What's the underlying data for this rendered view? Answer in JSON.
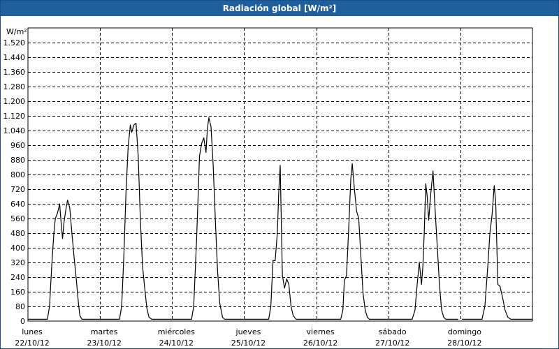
{
  "window": {
    "title": "Radiación global [W/m²]"
  },
  "chart_data": {
    "type": "line",
    "title": "Radiación global [W/m²]",
    "ylabel": "W/m²",
    "ylim": [
      0,
      1600
    ],
    "yticks": [
      {
        "value": 0,
        "label": "0"
      },
      {
        "value": 80,
        "label": "80"
      },
      {
        "value": 160,
        "label": "160"
      },
      {
        "value": 240,
        "label": "240"
      },
      {
        "value": 320,
        "label": "320"
      },
      {
        "value": 400,
        "label": "400"
      },
      {
        "value": 480,
        "label": "480"
      },
      {
        "value": 560,
        "label": "560"
      },
      {
        "value": 640,
        "label": "640"
      },
      {
        "value": 720,
        "label": "720"
      },
      {
        "value": 800,
        "label": "800"
      },
      {
        "value": 880,
        "label": "880"
      },
      {
        "value": 960,
        "label": "960"
      },
      {
        "value": 1040,
        "label": "1.040"
      },
      {
        "value": 1120,
        "label": "1.120"
      },
      {
        "value": 1200,
        "label": "1.200"
      },
      {
        "value": 1280,
        "label": "1.280"
      },
      {
        "value": 1360,
        "label": "1.360"
      },
      {
        "value": 1440,
        "label": "1.440"
      },
      {
        "value": 1520,
        "label": "1.520"
      }
    ],
    "xlim": [
      0,
      7
    ],
    "xticks": [
      {
        "day": "lunes",
        "date": "22/10/12"
      },
      {
        "day": "martes",
        "date": "23/10/12"
      },
      {
        "day": "miércoles",
        "date": "24/10/12"
      },
      {
        "day": "jueves",
        "date": "25/10/12"
      },
      {
        "day": "viernes",
        "date": "26/10/12"
      },
      {
        "day": "sábado",
        "date": "27/10/12"
      },
      {
        "day": "domingo",
        "date": "28/10/12"
      }
    ],
    "grid": true,
    "series": [
      {
        "color": "#000000",
        "segments": [
          [
            [
              0.0,
              10
            ],
            [
              0.27,
              10
            ],
            [
              0.3,
              80
            ],
            [
              0.33,
              300
            ],
            [
              0.36,
              480
            ],
            [
              0.38,
              560
            ],
            [
              0.41,
              590
            ],
            [
              0.44,
              640
            ],
            [
              0.46,
              540
            ],
            [
              0.48,
              450
            ],
            [
              0.5,
              540
            ],
            [
              0.53,
              620
            ],
            [
              0.55,
              660
            ],
            [
              0.58,
              620
            ],
            [
              0.61,
              480
            ],
            [
              0.64,
              350
            ],
            [
              0.67,
              230
            ],
            [
              0.7,
              100
            ],
            [
              0.72,
              30
            ],
            [
              0.75,
              10
            ],
            [
              1.27,
              10
            ],
            [
              1.3,
              80
            ],
            [
              1.33,
              350
            ],
            [
              1.36,
              700
            ],
            [
              1.39,
              950
            ],
            [
              1.42,
              1070
            ],
            [
              1.44,
              1030
            ],
            [
              1.47,
              1070
            ],
            [
              1.5,
              1080
            ],
            [
              1.53,
              900
            ],
            [
              1.56,
              550
            ],
            [
              1.59,
              300
            ],
            [
              1.62,
              180
            ],
            [
              1.65,
              70
            ],
            [
              1.68,
              20
            ],
            [
              1.72,
              10
            ],
            [
              2.27,
              10
            ],
            [
              2.3,
              80
            ],
            [
              2.34,
              450
            ],
            [
              2.38,
              900
            ],
            [
              2.41,
              970
            ],
            [
              2.44,
              1000
            ],
            [
              2.47,
              920
            ],
            [
              2.49,
              1050
            ],
            [
              2.51,
              1110
            ],
            [
              2.54,
              1060
            ],
            [
              2.57,
              850
            ],
            [
              2.6,
              550
            ],
            [
              2.63,
              280
            ],
            [
              2.66,
              100
            ],
            [
              2.7,
              20
            ],
            [
              2.73,
              10
            ],
            [
              3.34,
              10
            ],
            [
              3.37,
              80
            ],
            [
              3.4,
              330
            ],
            [
              3.43,
              330
            ],
            [
              3.46,
              480
            ],
            [
              3.48,
              700
            ],
            [
              3.5,
              850
            ],
            [
              3.53,
              250
            ],
            [
              3.56,
              180
            ],
            [
              3.59,
              230
            ],
            [
              3.62,
              200
            ],
            [
              3.65,
              80
            ],
            [
              3.68,
              30
            ],
            [
              3.72,
              10
            ],
            [
              4.34,
              10
            ],
            [
              4.37,
              60
            ],
            [
              4.39,
              220
            ],
            [
              4.42,
              250
            ],
            [
              4.45,
              500
            ],
            [
              4.48,
              780
            ],
            [
              4.5,
              860
            ],
            [
              4.53,
              720
            ],
            [
              4.56,
              600
            ],
            [
              4.59,
              560
            ],
            [
              4.62,
              350
            ],
            [
              4.65,
              150
            ],
            [
              4.68,
              60
            ],
            [
              4.71,
              20
            ],
            [
              4.74,
              10
            ],
            [
              5.33,
              10
            ],
            [
              5.37,
              60
            ],
            [
              5.4,
              200
            ],
            [
              5.43,
              320
            ],
            [
              5.46,
              200
            ],
            [
              5.48,
              300
            ],
            [
              5.5,
              500
            ],
            [
              5.52,
              750
            ],
            [
              5.54,
              680
            ],
            [
              5.56,
              550
            ],
            [
              5.59,
              700
            ],
            [
              5.62,
              820
            ],
            [
              5.65,
              600
            ],
            [
              5.68,
              400
            ],
            [
              5.71,
              200
            ],
            [
              5.74,
              60
            ],
            [
              5.77,
              20
            ],
            [
              5.8,
              10
            ],
            [
              5.97,
              10
            ]
          ],
          [
            [
              6.02,
              10
            ],
            [
              6.3,
              10
            ],
            [
              6.34,
              80
            ],
            [
              6.38,
              300
            ],
            [
              6.41,
              480
            ],
            [
              6.44,
              580
            ],
            [
              6.47,
              740
            ],
            [
              6.49,
              650
            ],
            [
              6.52,
              200
            ],
            [
              6.55,
              190
            ],
            [
              6.59,
              120
            ],
            [
              6.62,
              60
            ],
            [
              6.66,
              20
            ],
            [
              6.7,
              10
            ],
            [
              7.0,
              10
            ]
          ]
        ]
      }
    ]
  }
}
